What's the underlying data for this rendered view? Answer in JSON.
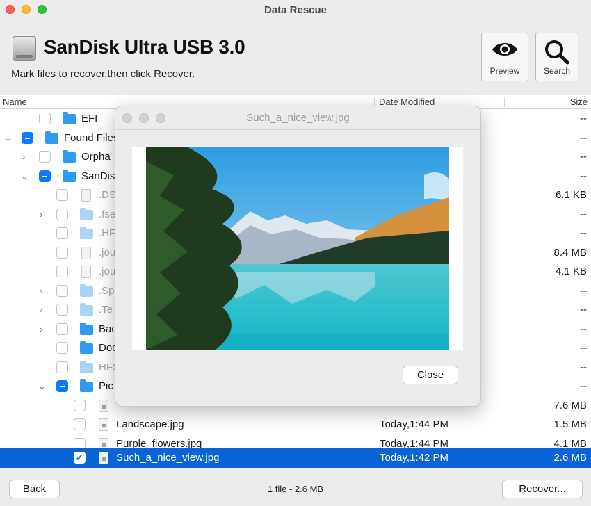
{
  "window": {
    "title": "Data Rescue"
  },
  "header": {
    "drive_name": "SanDisk Ultra USB 3.0",
    "instructions": "Mark files to recover,then click Recover.",
    "preview_label": "Preview",
    "search_label": "Search"
  },
  "columns": {
    "name": "Name",
    "date": "Date Modified",
    "size": "Size"
  },
  "rows": [
    {
      "name": "EFI",
      "date": "",
      "size": "--"
    },
    {
      "name": "Found Files",
      "date": "",
      "size": "--"
    },
    {
      "name": "Orpha",
      "date": "",
      "size": "--"
    },
    {
      "name": "SanDisk",
      "date": "",
      "size": "--"
    },
    {
      "name": ".DS",
      "date": "",
      "size": "6.1 KB"
    },
    {
      "name": ".fse",
      "date": "",
      "size": "--"
    },
    {
      "name": ".HF",
      "date": "",
      "size": "--"
    },
    {
      "name": ".jou",
      "date": "",
      "size": "8.4 MB"
    },
    {
      "name": ".jou",
      "date": "",
      "size": "4.1 KB"
    },
    {
      "name": ".Sp",
      "date": "",
      "size": "--"
    },
    {
      "name": ".Te",
      "date": "",
      "size": "--"
    },
    {
      "name": "Bac",
      "date": "",
      "size": "--"
    },
    {
      "name": "Doc",
      "date": "",
      "size": "--"
    },
    {
      "name": "HFS",
      "date": "",
      "size": "--"
    },
    {
      "name": "Pic",
      "date": "",
      "size": "--"
    },
    {
      "name": "",
      "date": "",
      "size": "7.6 MB"
    },
    {
      "name": "Landscape.jpg",
      "date": "Today,1:44 PM",
      "size": "1.5 MB"
    },
    {
      "name": "Purple_flowers.jpg",
      "date": "Today,1:44 PM",
      "size": "4.1 MB"
    },
    {
      "name": "Such_a_nice_view.jpg",
      "date": "Today,1:42 PM",
      "size": "2.6 MB"
    }
  ],
  "footer": {
    "back_label": "Back",
    "status": "1 file - 2.6 MB",
    "recover_label": "Recover..."
  },
  "preview_window": {
    "title": "Such_a_nice_view.jpg",
    "close_label": "Close"
  },
  "colors": {
    "selection": "#0a64d7",
    "folder": "#2f9bf0",
    "checkbox_mixed": "#0a7aff"
  }
}
